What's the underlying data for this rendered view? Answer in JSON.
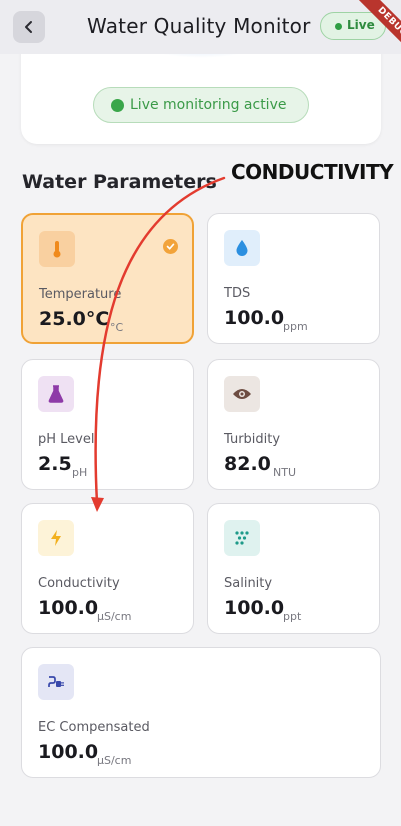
{
  "app": {
    "title": "Water Quality Monitor",
    "live_badge": "Live",
    "debug_banner": "DEBUG"
  },
  "status": {
    "live_text": "Live monitoring active"
  },
  "section_title": "Water Parameters",
  "annotation": {
    "label": "CONDUCTIVITY",
    "color": "#e33b2f"
  },
  "colors": {
    "accent_orange": "#f0a236",
    "live_green": "#3aa64a"
  },
  "parameters": [
    {
      "name": "Temperature",
      "value": "25.0°C",
      "unit": "°C",
      "icon": "thermometer-icon",
      "selected": true
    },
    {
      "name": "TDS",
      "value": "100.0",
      "unit": "ppm",
      "icon": "water-drop-icon",
      "selected": false
    },
    {
      "name": "pH Level",
      "value": "2.5",
      "unit": "pH",
      "icon": "flask-icon",
      "selected": false
    },
    {
      "name": "Turbidity",
      "value": "82.0",
      "unit": "NTU",
      "icon": "eye-icon",
      "selected": false
    },
    {
      "name": "Conductivity",
      "value": "100.0",
      "unit": "μS/cm",
      "icon": "bolt-icon",
      "selected": false
    },
    {
      "name": "Salinity",
      "value": "100.0",
      "unit": "ppt",
      "icon": "grain-icon",
      "selected": false
    },
    {
      "name": "EC Compensated",
      "value": "100.0",
      "unit": "μS/cm",
      "icon": "electrical-plug-icon",
      "selected": false
    }
  ]
}
